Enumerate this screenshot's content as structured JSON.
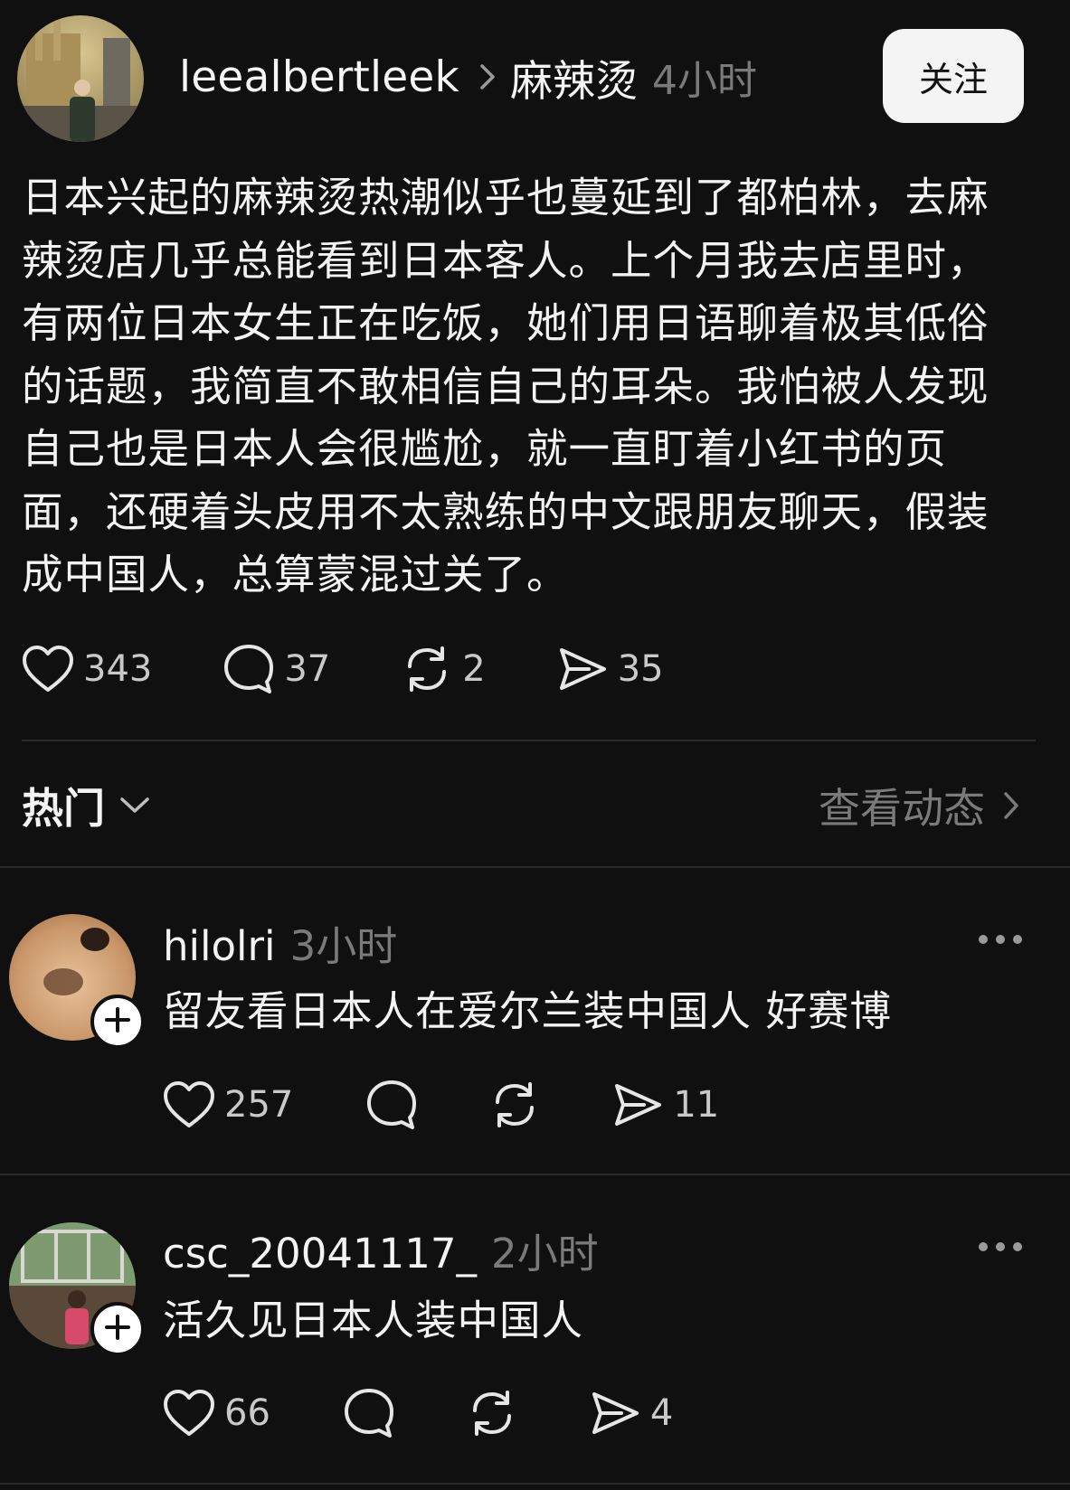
{
  "post": {
    "username": "leealbertleek",
    "topic": "麻辣烫",
    "time": "4小时",
    "follow_label": "关注",
    "body": "日本兴起的麻辣烫热潮似乎也蔓延到了都柏林，去麻辣烫店几乎总能看到日本客人。上个月我去店里时，有两位日本女生正在吃饭，她们用日语聊着极其低俗的话题，我简直不敢相信自己的耳朵。我怕被人发现自己也是日本人会很尴尬，就一直盯着小红书的页面，还硬着头皮用不太熟练的中文跟朋友聊天，假装成中国人，总算蒙混过关了。",
    "likes": "343",
    "comments": "37",
    "reposts": "2",
    "shares": "35"
  },
  "section": {
    "hot_label": "热门",
    "view_activity_label": "查看动态"
  },
  "comments": [
    {
      "username": "hilolri",
      "time": "3小时",
      "text": "留友看日本人在爱尔兰装中国人 好赛博",
      "likes": "257",
      "shares": "11"
    },
    {
      "username": "csc_20041117_",
      "time": "2小时",
      "text": "活久见日本人装中国人",
      "likes": "66",
      "shares": "4"
    }
  ],
  "icons": {
    "like": "heart-icon",
    "comment": "speech-bubble-icon",
    "repost": "repost-icon",
    "share": "send-icon",
    "more": "more-dots-icon",
    "follow_plus": "plus-icon"
  },
  "colors": {
    "background": "#101010",
    "text": "#f3f3f3",
    "muted": "#7a7a7a",
    "follow_button": "#f4f4f4"
  }
}
